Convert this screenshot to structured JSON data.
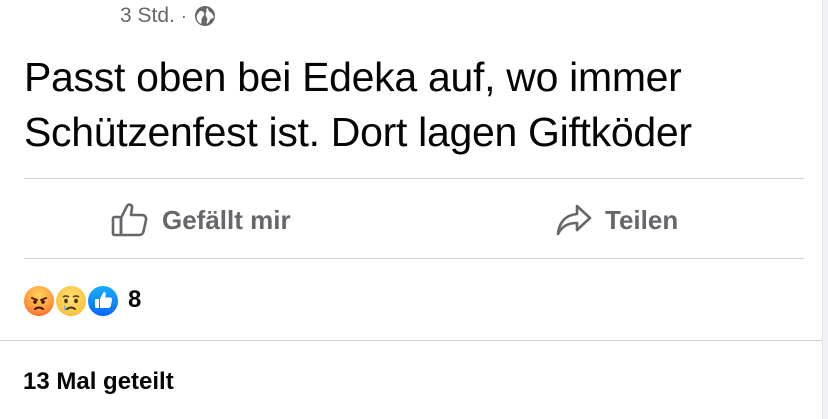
{
  "post": {
    "timestamp": "3 Std.",
    "separator": "·",
    "audience_icon": "globe-icon",
    "text_lines": [
      "Passt oben bei Edeka auf, wo immer",
      "Schützenfest ist. Dort lagen Giftköder"
    ]
  },
  "actions": {
    "like_label": "Gefällt mir",
    "like_icon": "thumbs-up-outline-icon",
    "share_label": "Teilen",
    "share_icon": "share-arrow-icon"
  },
  "reactions": {
    "icons": [
      "angry-reaction-icon",
      "sad-reaction-icon",
      "like-reaction-icon"
    ],
    "count": "8"
  },
  "shares": {
    "label": "13 Mal geteilt"
  },
  "colors": {
    "text_primary": "#050505",
    "text_secondary": "#65676b",
    "divider": "#ced0d4",
    "like_blue": "#0866ff"
  }
}
